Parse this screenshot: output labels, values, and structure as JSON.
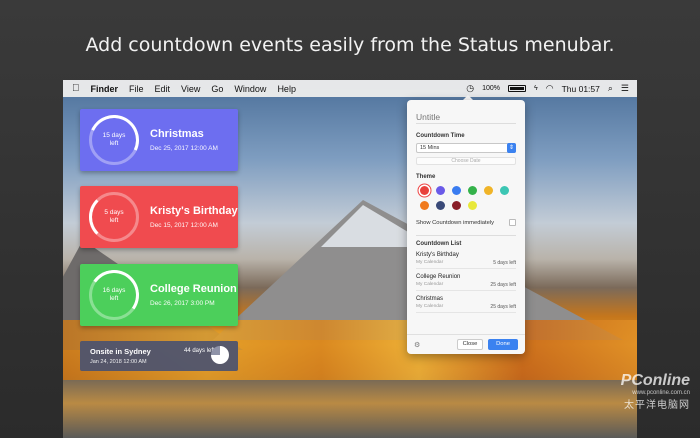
{
  "headline": "Add countdown events easily from the Status menubar.",
  "menubar": {
    "apple": "",
    "items": [
      "Finder",
      "File",
      "Edit",
      "View",
      "Go",
      "Window",
      "Help"
    ],
    "battery": "100%",
    "battery_level": 1.0,
    "clock": "Thu 01:57"
  },
  "widgets": [
    {
      "days": "15 days",
      "left": "left",
      "title": "Christmas",
      "date": "Dec 25, 2017 12:00 AM",
      "color": "#6d6ef0"
    },
    {
      "days": "5 days",
      "left": "left",
      "title": "Kristy's Birthday",
      "date": "Dec 15, 2017 12:00 AM",
      "color": "#f04b4f"
    },
    {
      "days": "16 days",
      "left": "left",
      "title": "College Reunion",
      "date": "Dec 26, 2017 3:00 PM",
      "color": "#4ccf5b"
    }
  ],
  "mini": {
    "title": "Onsite in Sydney",
    "days": "44 days left",
    "date": "Jan 24, 2018 12:00 AM"
  },
  "popover": {
    "title_placeholder": "Untitle",
    "time_label": "Countdown Time",
    "time_value": "15 Mins",
    "choose_date": "Choose Date",
    "theme_label": "Theme",
    "theme_colors": [
      "#e8413c",
      "#6a5ae8",
      "#3a7cf0",
      "#34b24a",
      "#f0b428",
      "#3cc6b4",
      "#f07a1e",
      "#3a4a78",
      "#8a1e28",
      "#e8e83a"
    ],
    "show_label": "Show Countdown immediately",
    "list_label": "Countdown List",
    "list": [
      {
        "name": "Kristy's Birthday",
        "cal": "My Calendar",
        "days": "5 days left"
      },
      {
        "name": "College Reunion",
        "cal": "My Calendar",
        "days": "25 days left"
      },
      {
        "name": "Christmas",
        "cal": "My Calendar",
        "days": "25 days left"
      }
    ],
    "close": "Close",
    "done": "Done"
  },
  "watermark": {
    "brand": "PConline",
    "url": "www.pconline.com.cn",
    "cn": "太平洋电脑网"
  }
}
